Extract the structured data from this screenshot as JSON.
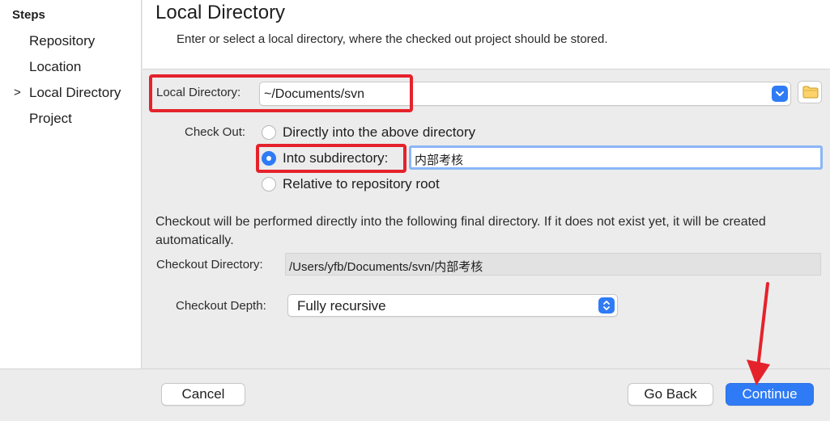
{
  "sidebar": {
    "heading": "Steps",
    "steps": [
      {
        "label": "Repository"
      },
      {
        "label": "Location"
      },
      {
        "label": "Local Directory"
      },
      {
        "label": "Project"
      }
    ],
    "current_marker": ">"
  },
  "header": {
    "title": "Local Directory",
    "description": "Enter or select a local directory, where the checked out project should be stored."
  },
  "local_directory": {
    "label": "Local Directory:",
    "value": "~/Documents/svn"
  },
  "checkout": {
    "label": "Check Out:",
    "options": [
      {
        "label": "Directly into the above directory",
        "selected": false
      },
      {
        "label": "Into subdirectory:",
        "selected": true
      },
      {
        "label": "Relative to repository root",
        "selected": false
      }
    ],
    "subdirectory_value": "内部考核"
  },
  "info_text": "Checkout will be performed directly into the following final directory. If it does not exist yet, it will be created automatically.",
  "checkout_directory": {
    "label": "Checkout Directory:",
    "value": "/Users/yfb/Documents/svn/内部考核"
  },
  "checkout_depth": {
    "label": "Checkout Depth:",
    "value": "Fully recursive"
  },
  "footer": {
    "cancel_label": "Cancel",
    "back_label": "Go Back",
    "continue_label": "Continue"
  },
  "colors": {
    "accent": "#2f7bf5",
    "annotation": "#e5222b"
  }
}
